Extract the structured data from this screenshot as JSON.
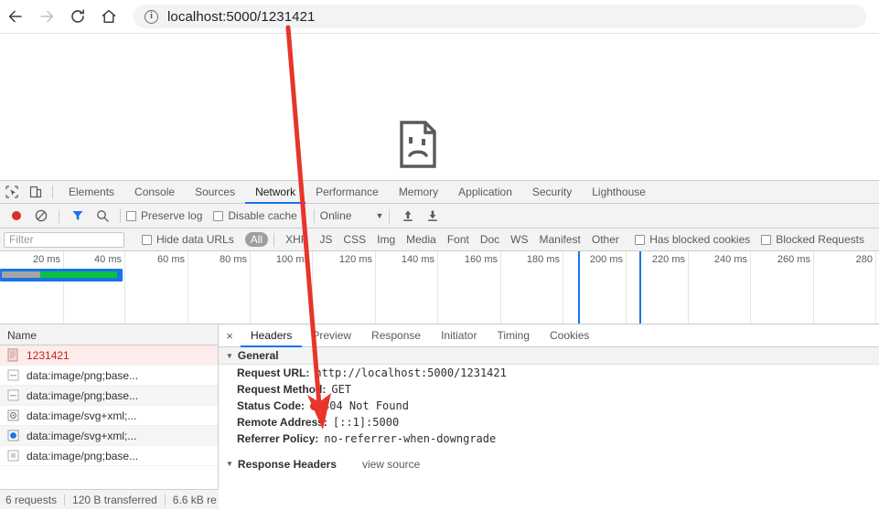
{
  "browser": {
    "back_label": "back-arrow",
    "forward_label": "forward-arrow",
    "reload_label": "reload",
    "home_label": "home",
    "url": "localhost:5000/1231421",
    "url_host": "localhost:5000",
    "url_path": "/1231421"
  },
  "page": {
    "broken_image_alt": "broken-image"
  },
  "devtools": {
    "tabs": [
      {
        "label": "Elements",
        "active": false
      },
      {
        "label": "Console",
        "active": false
      },
      {
        "label": "Sources",
        "active": false
      },
      {
        "label": "Network",
        "active": true
      },
      {
        "label": "Performance",
        "active": false
      },
      {
        "label": "Memory",
        "active": false
      },
      {
        "label": "Application",
        "active": false
      },
      {
        "label": "Security",
        "active": false
      },
      {
        "label": "Lighthouse",
        "active": false
      }
    ],
    "toolbar": {
      "record_label": "record",
      "clear_label": "clear",
      "filter_label": "filter",
      "search_label": "search",
      "preserve_log": "Preserve log",
      "disable_cache": "Disable cache",
      "throttle_value": "Online",
      "import_label": "import-har",
      "export_label": "export-har"
    },
    "filter_bar": {
      "filter_placeholder": "Filter",
      "hide_data_urls": "Hide data URLs",
      "types": [
        {
          "label": "All",
          "active": true
        },
        {
          "label": "XHR",
          "active": false
        },
        {
          "label": "JS",
          "active": false
        },
        {
          "label": "CSS",
          "active": false
        },
        {
          "label": "Img",
          "active": false
        },
        {
          "label": "Media",
          "active": false
        },
        {
          "label": "Font",
          "active": false
        },
        {
          "label": "Doc",
          "active": false
        },
        {
          "label": "WS",
          "active": false
        },
        {
          "label": "Manifest",
          "active": false
        },
        {
          "label": "Other",
          "active": false
        }
      ],
      "has_blocked_cookies": "Has blocked cookies",
      "blocked_requests": "Blocked Requests"
    },
    "overview": {
      "ticks": [
        "20 ms",
        "40 ms",
        "60 ms",
        "80 ms",
        "100 ms",
        "120 ms",
        "140 ms",
        "160 ms",
        "180 ms",
        "200 ms",
        "220 ms",
        "240 ms",
        "260 ms",
        "280"
      ],
      "event_line_color": "#1a73e8",
      "band_color": "#1a73e8",
      "bar_wait_color": "#a5a5a5",
      "bar_download_color": "#0cc043"
    },
    "requests": {
      "column_header": "Name",
      "rows": [
        {
          "name": "1231421",
          "icon": "document-icon",
          "selected": true
        },
        {
          "name": "data:image/png;base...",
          "icon": "image-icon",
          "selected": false
        },
        {
          "name": "data:image/png;base...",
          "icon": "image-icon",
          "selected": false
        },
        {
          "name": "data:image/svg+xml;...",
          "icon": "svg-icon",
          "selected": false
        },
        {
          "name": "data:image/svg+xml;...",
          "icon": "svg-blue-icon",
          "selected": false
        },
        {
          "name": "data:image/png;base...",
          "icon": "image-small-icon",
          "selected": false
        }
      ]
    },
    "detail": {
      "close_label": "×",
      "tabs": [
        {
          "label": "Headers",
          "active": true
        },
        {
          "label": "Preview",
          "active": false
        },
        {
          "label": "Response",
          "active": false
        },
        {
          "label": "Initiator",
          "active": false
        },
        {
          "label": "Timing",
          "active": false
        },
        {
          "label": "Cookies",
          "active": false
        }
      ],
      "general_section": "General",
      "general": [
        {
          "key": "Request URL:",
          "value": "http://localhost:5000/1231421"
        },
        {
          "key": "Request Method:",
          "value": "GET"
        },
        {
          "key": "Status Code:",
          "value": "404 Not Found",
          "status": true
        },
        {
          "key": "Remote Address:",
          "value": "[::1]:5000"
        },
        {
          "key": "Referrer Policy:",
          "value": "no-referrer-when-downgrade"
        }
      ],
      "response_headers_section": "Response Headers",
      "view_source": "view source"
    },
    "status_bar": {
      "requests": "6 requests",
      "transferred": "120 B transferred",
      "resources": "6.6 kB re"
    }
  },
  "annotation": {
    "arrow_color": "#e8342a",
    "arrow_label": "red-pointer-arrow"
  }
}
